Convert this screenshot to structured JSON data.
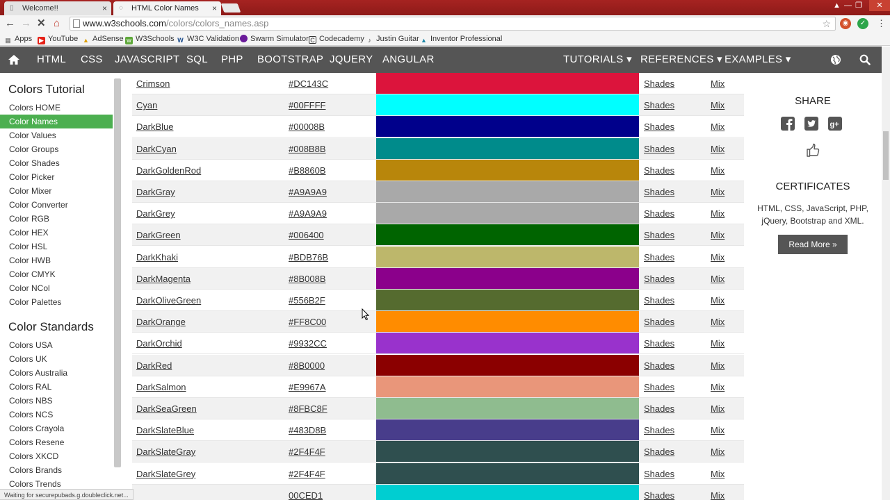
{
  "browser": {
    "tabs": [
      {
        "title": "Welcome!!",
        "active": false
      },
      {
        "title": "HTML Color Names",
        "active": true
      }
    ],
    "url_host": "www.w3schools.com",
    "url_path": "/colors/colors_names.asp",
    "bookmarks": [
      "Apps",
      "YouTube",
      "AdSense",
      "W3Schools",
      "W3C Validation",
      "Swarm Simulator",
      "Codecademy",
      "Justin Guitar",
      "Inventor Professional"
    ],
    "status": "Waiting for securepubads.g.doubleclick.net..."
  },
  "sitenav": {
    "left": [
      "HTML",
      "CSS",
      "JAVASCRIPT",
      "SQL",
      "PHP",
      "BOOTSTRAP",
      "JQUERY",
      "ANGULAR"
    ],
    "right": [
      "TUTORIALS ▾",
      "REFERENCES ▾",
      "EXAMPLES ▾"
    ]
  },
  "sidebar": {
    "heading1": "Colors Tutorial",
    "items1": [
      "Colors HOME",
      "Color Names",
      "Color Values",
      "Color Groups",
      "Color Shades",
      "Color Picker",
      "Color Mixer",
      "Color Converter",
      "Color RGB",
      "Color HEX",
      "Color HSL",
      "Color HWB",
      "Color CMYK",
      "Color NCol",
      "Color Palettes"
    ],
    "active_item": "Color Names",
    "heading2": "Color Standards",
    "items2": [
      "Colors USA",
      "Colors UK",
      "Colors Australia",
      "Colors RAL",
      "Colors NBS",
      "Colors NCS",
      "Colors Crayola",
      "Colors Resene",
      "Colors XKCD",
      "Colors Brands",
      "Colors Trends"
    ]
  },
  "colors": [
    {
      "name": "Crimson",
      "hex": "#DC143C"
    },
    {
      "name": "Cyan",
      "hex": "#00FFFF"
    },
    {
      "name": "DarkBlue",
      "hex": "#00008B"
    },
    {
      "name": "DarkCyan",
      "hex": "#008B8B"
    },
    {
      "name": "DarkGoldenRod",
      "hex": "#B8860B"
    },
    {
      "name": "DarkGray",
      "hex": "#A9A9A9"
    },
    {
      "name": "DarkGrey",
      "hex": "#A9A9A9"
    },
    {
      "name": "DarkGreen",
      "hex": "#006400"
    },
    {
      "name": "DarkKhaki",
      "hex": "#BDB76B"
    },
    {
      "name": "DarkMagenta",
      "hex": "#8B008B"
    },
    {
      "name": "DarkOliveGreen",
      "hex": "#556B2F"
    },
    {
      "name": "DarkOrange",
      "hex": "#FF8C00"
    },
    {
      "name": "DarkOrchid",
      "hex": "#9932CC"
    },
    {
      "name": "DarkRed",
      "hex": "#8B0000"
    },
    {
      "name": "DarkSalmon",
      "hex": "#E9967A"
    },
    {
      "name": "DarkSeaGreen",
      "hex": "#8FBC8F"
    },
    {
      "name": "DarkSlateBlue",
      "hex": "#483D8B"
    },
    {
      "name": "DarkSlateGray",
      "hex": "#2F4F4F"
    },
    {
      "name": "DarkSlateGrey",
      "hex": "#2F4F4F"
    },
    {
      "name": "",
      "hex": "#00CED1",
      "hex_visible": "00CED1"
    }
  ],
  "row_links": {
    "shades": "Shades",
    "mix": "Mix"
  },
  "rightcol": {
    "share_heading": "SHARE",
    "certificates_heading": "CERTIFICATES",
    "cert_text_line1": "HTML, CSS, JavaScript, PHP,",
    "cert_text_line2": "jQuery, Bootstrap and XML.",
    "read_more": "Read More »"
  },
  "theme": {
    "nav_bg": "#555555",
    "active_green": "#4CAF50",
    "tabstrip_red": "#A62321"
  }
}
